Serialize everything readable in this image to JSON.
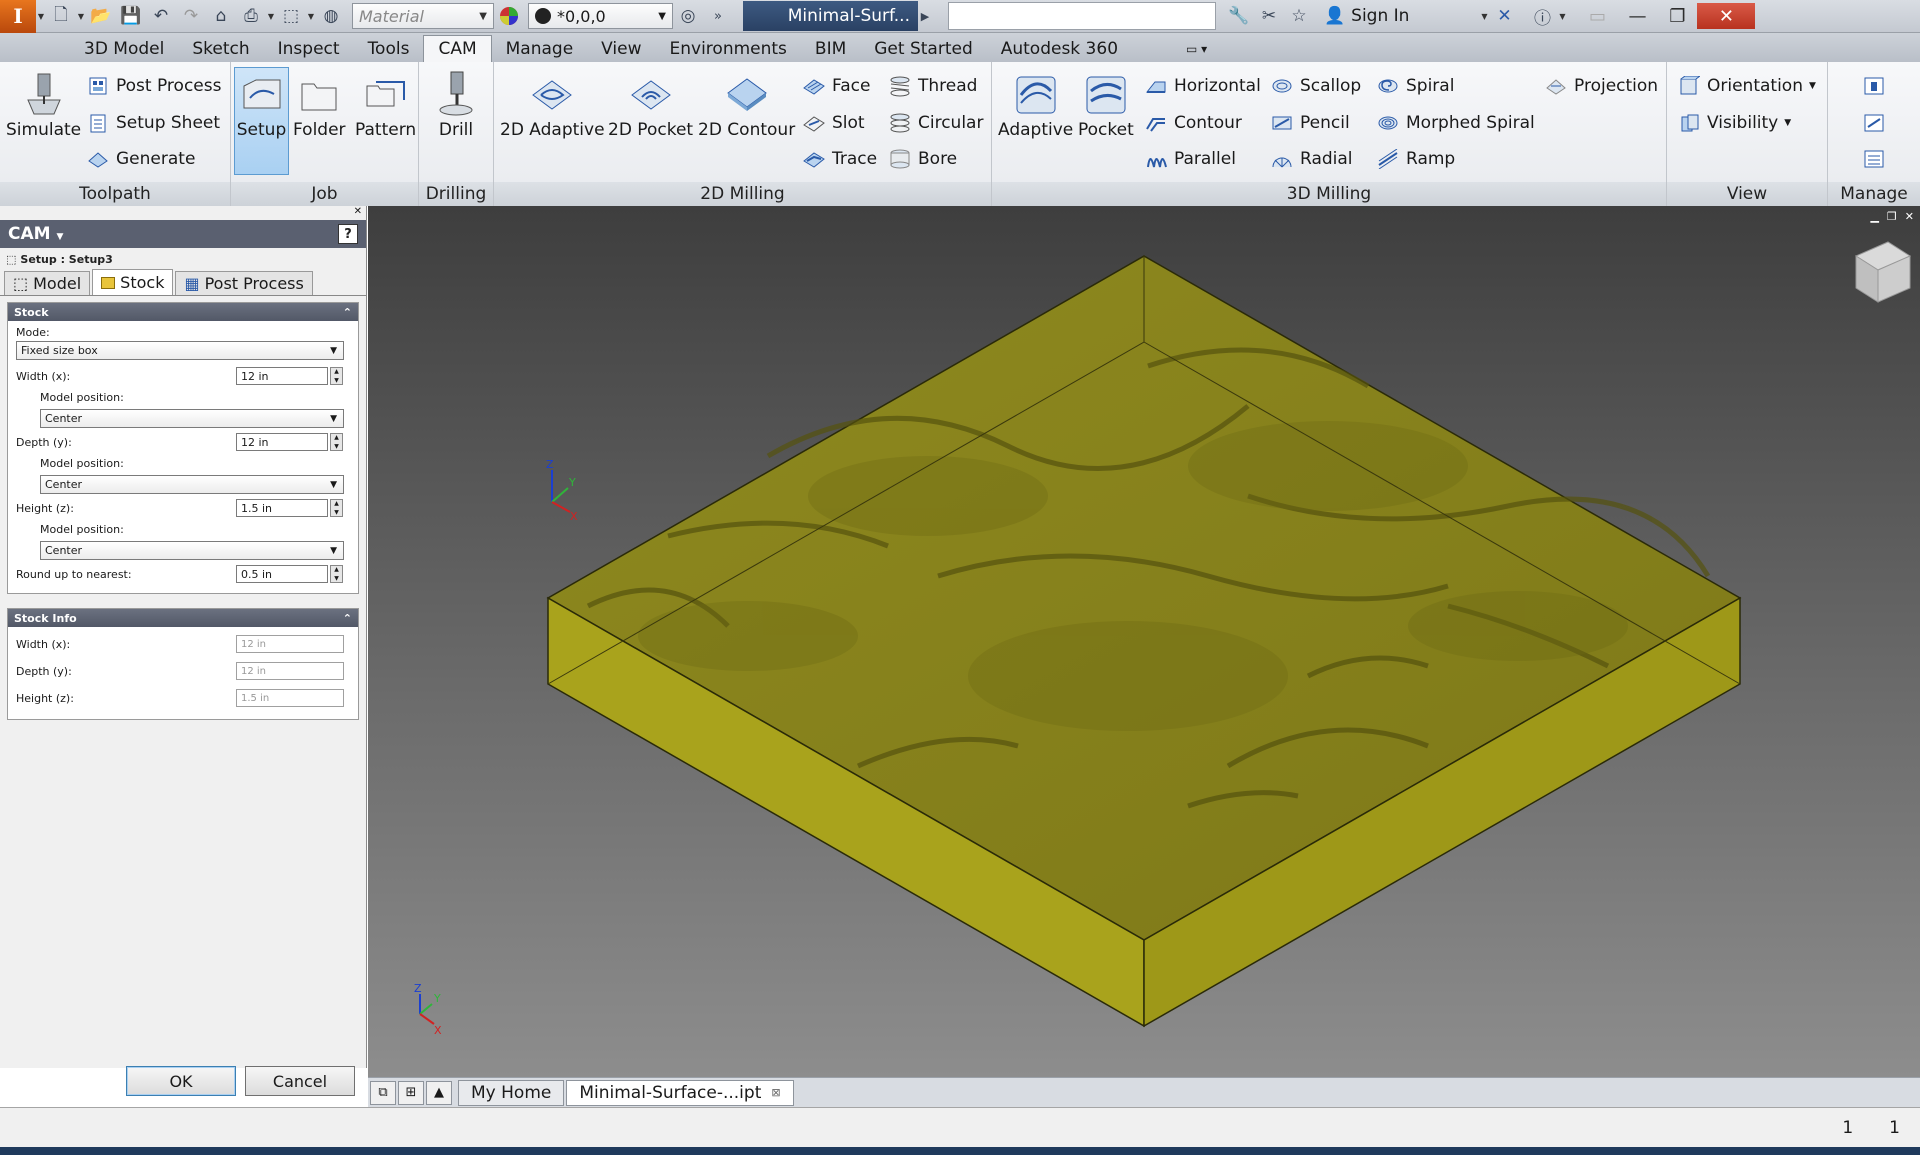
{
  "titlebar": {
    "logo": "I",
    "material": "Material",
    "appearance": "*0,0,0",
    "doc_title": "Minimal-Surf...",
    "sign_in": "Sign In",
    "min": "—",
    "restore": "❐",
    "close": "✕"
  },
  "ribbon_tabs": [
    "3D Model",
    "Sketch",
    "Inspect",
    "Tools",
    "CAM",
    "Manage",
    "View",
    "Environments",
    "BIM",
    "Get Started",
    "Autodesk 360"
  ],
  "active_tab": "CAM",
  "panels": {
    "toolpath": {
      "label": "Toolpath",
      "simulate": "Simulate",
      "post_process": "Post Process",
      "setup_sheet": "Setup Sheet",
      "generate": "Generate"
    },
    "job": {
      "label": "Job",
      "setup": "Setup",
      "folder": "Folder",
      "pattern": "Pattern"
    },
    "drilling": {
      "label": "Drilling",
      "drill": "Drill"
    },
    "milling2d": {
      "label": "2D Milling",
      "adaptive": "2D Adaptive",
      "pocket": "2D Pocket",
      "contour": "2D Contour",
      "face": "Face",
      "slot": "Slot",
      "trace": "Trace",
      "thread": "Thread",
      "circular": "Circular",
      "bore": "Bore"
    },
    "milling3d": {
      "label": "3D Milling",
      "adaptive": "Adaptive",
      "pocket": "Pocket",
      "horizontal": "Horizontal",
      "contour": "Contour",
      "parallel": "Parallel",
      "scallop": "Scallop",
      "pencil": "Pencil",
      "radial": "Radial",
      "spiral": "Spiral",
      "morphed_spiral": "Morphed Spiral",
      "ramp": "Ramp",
      "projection": "Projection"
    },
    "view": {
      "label": "View",
      "orientation": "Orientation",
      "visibility": "Visibility"
    },
    "manage": {
      "label": "Manage"
    }
  },
  "cam_panel": {
    "title": "CAM",
    "help": "?",
    "setup_path": "Setup : Setup3",
    "tabs": {
      "model": "Model",
      "stock": "Stock",
      "post": "Post Process"
    },
    "stock": {
      "header": "Stock",
      "mode_label": "Mode:",
      "mode_value": "Fixed size box",
      "width_label": "Width (x):",
      "width_value": "12 in",
      "model_pos_label": "Model position:",
      "width_pos": "Center",
      "depth_label": "Depth (y):",
      "depth_value": "12 in",
      "depth_pos": "Center",
      "height_label": "Height (z):",
      "height_value": "1.5 in",
      "height_pos": "Center",
      "round_label": "Round up to nearest:",
      "round_value": "0.5 in"
    },
    "stock_info": {
      "header": "Stock Info",
      "width_label": "Width (x):",
      "width_value": "12 in",
      "depth_label": "Depth (y):",
      "depth_value": "12 in",
      "height_label": "Height (z):",
      "height_value": "1.5 in"
    },
    "ok": "OK",
    "cancel": "Cancel"
  },
  "doc_tabs": {
    "home": "My Home",
    "file": "Minimal-Surface-...ipt"
  },
  "status": {
    "a": "1",
    "b": "1"
  },
  "colors": {
    "stock": "#b3ad1e",
    "accent": "#5c9bd1"
  }
}
